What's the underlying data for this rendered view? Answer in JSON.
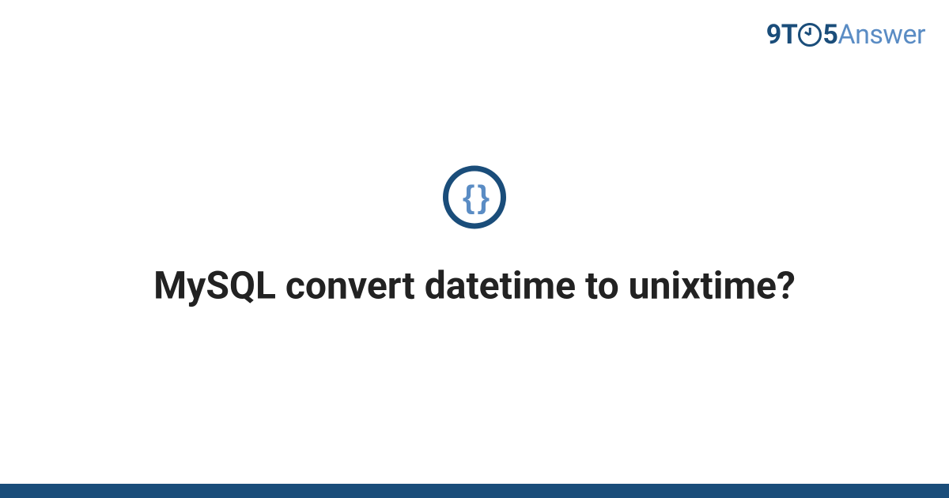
{
  "logo": {
    "part1": "9T",
    "part2": "5",
    "part3": "Answer"
  },
  "icon": {
    "name": "code-braces-icon",
    "glyph": "{ }"
  },
  "title": "MySQL convert datetime to unixtime?",
  "colors": {
    "brand_dark": "#1a4d7a",
    "brand_light": "#5a8cc4"
  }
}
